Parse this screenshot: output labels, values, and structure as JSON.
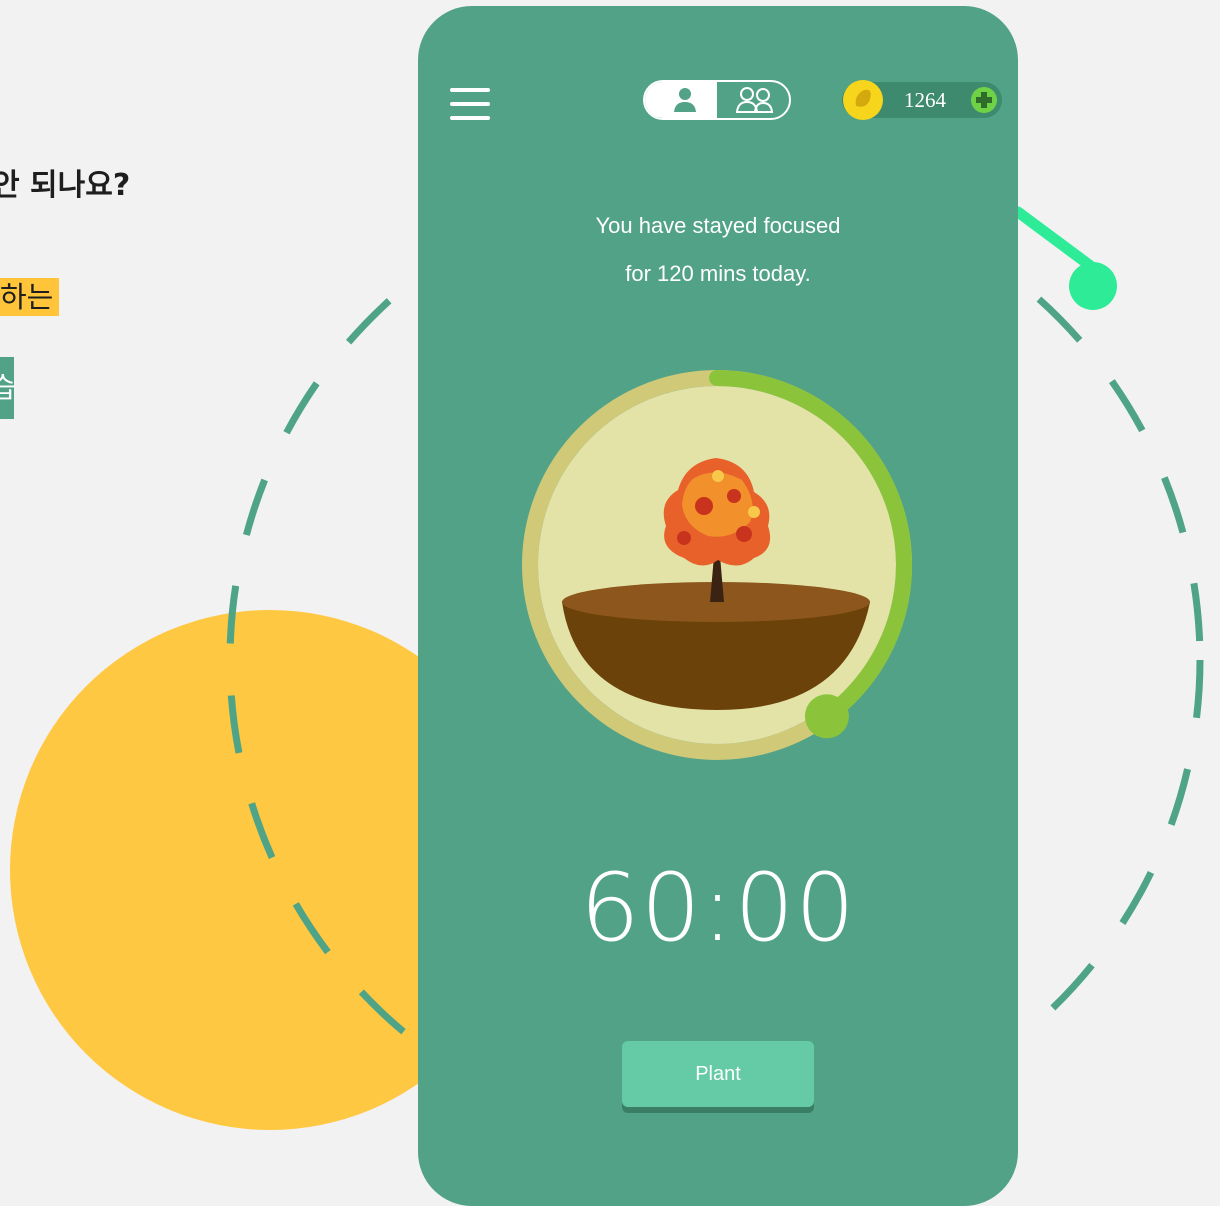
{
  "background": {
    "heading_text": "안 되나요?",
    "highlight_line_1": "하는",
    "highlight_line_2": "습",
    "colors": {
      "page": "#f2f2f2",
      "yellow_circle": "#ffc843",
      "dashed_ring": "#4fa487",
      "accent_arc": "#2eeb98"
    }
  },
  "phone": {
    "background_color": "#51a287",
    "header": {
      "menu_icon": "hamburger-menu-icon",
      "mode_toggle": {
        "options": [
          {
            "icon": "single-user-icon",
            "selected": true
          },
          {
            "icon": "group-users-icon",
            "selected": false
          }
        ]
      },
      "coins": {
        "icon": "coin-icon",
        "count": "1264",
        "add_icon": "plus-circle-icon"
      }
    },
    "focus_message": {
      "line1": "You have stayed focused",
      "line2": "for 120 mins today."
    },
    "progress_ring": {
      "progress_fraction": 0.4,
      "colors": {
        "track": "#cfc978",
        "fill": "#8bc43a",
        "inner_disc": "#e3e3a8"
      }
    },
    "tree_illustration": "autumn-tree-icon",
    "timer": "60:00",
    "plant_button": "Plant"
  }
}
